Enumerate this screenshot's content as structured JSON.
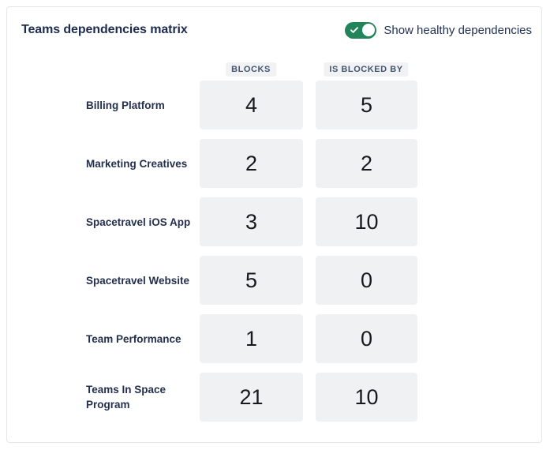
{
  "header": {
    "title": "Teams dependencies matrix",
    "toggle": {
      "label": "Show healthy dependencies",
      "state": "on",
      "on_color": "#22845b",
      "knob_color": "#ffffff",
      "icon": "check-icon"
    }
  },
  "matrix": {
    "column_headers": [
      "BLOCKS",
      "IS BLOCKED BY"
    ],
    "rows": [
      {
        "team": "Billing Platform",
        "blocks": "4",
        "is_blocked_by": "5"
      },
      {
        "team": "Marketing Creatives",
        "blocks": "2",
        "is_blocked_by": "2"
      },
      {
        "team": "Spacetravel iOS App",
        "blocks": "3",
        "is_blocked_by": "10"
      },
      {
        "team": "Spacetravel Website",
        "blocks": "5",
        "is_blocked_by": "0"
      },
      {
        "team": "Team Performance",
        "blocks": "1",
        "is_blocked_by": "0"
      },
      {
        "team": "Teams In Space Program",
        "blocks": "21",
        "is_blocked_by": "10"
      }
    ]
  },
  "colors": {
    "card_border": "#e6e7ea",
    "cell_background": "#f0f1f3",
    "chip_background": "#f1f2f4",
    "chip_text": "#44546f",
    "title_text": "#1d2b4f",
    "value_text": "#18191c"
  },
  "chart_data": {
    "type": "table",
    "title": "Teams dependencies matrix",
    "columns": [
      "Team",
      "Blocks",
      "Is blocked by"
    ],
    "categories": [
      "Billing Platform",
      "Marketing Creatives",
      "Spacetravel iOS App",
      "Spacetravel Website",
      "Team Performance",
      "Teams In Space Program"
    ],
    "series": [
      {
        "name": "Blocks",
        "values": [
          4,
          2,
          3,
          5,
          1,
          21
        ]
      },
      {
        "name": "Is blocked by",
        "values": [
          5,
          2,
          10,
          0,
          0,
          10
        ]
      }
    ]
  }
}
